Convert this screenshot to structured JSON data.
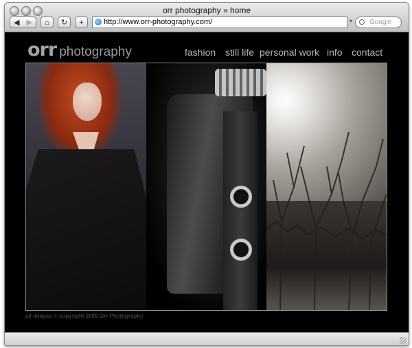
{
  "window": {
    "title": "orr photography » home"
  },
  "toolbar": {
    "back_icon": "back-arrow-icon",
    "forward_icon": "forward-arrow-icon",
    "home_icon": "home-icon",
    "reload_icon": "reload-icon",
    "add_icon": "plus-icon",
    "address": "http://www.orr-photography.com/",
    "search_placeholder": "Google"
  },
  "site": {
    "logo_primary": "orr",
    "logo_secondary": "photography",
    "nav": [
      {
        "label": "fashion"
      },
      {
        "label": "still life"
      },
      {
        "label": "personal work"
      },
      {
        "label": "info"
      },
      {
        "label": "contact"
      }
    ],
    "copyright": "all images © copyright 2005 Orr Photography"
  },
  "colors": {
    "page_background": "#000000",
    "nav_text": "#b5b5b5",
    "logo_text": "#9a9a9a"
  }
}
